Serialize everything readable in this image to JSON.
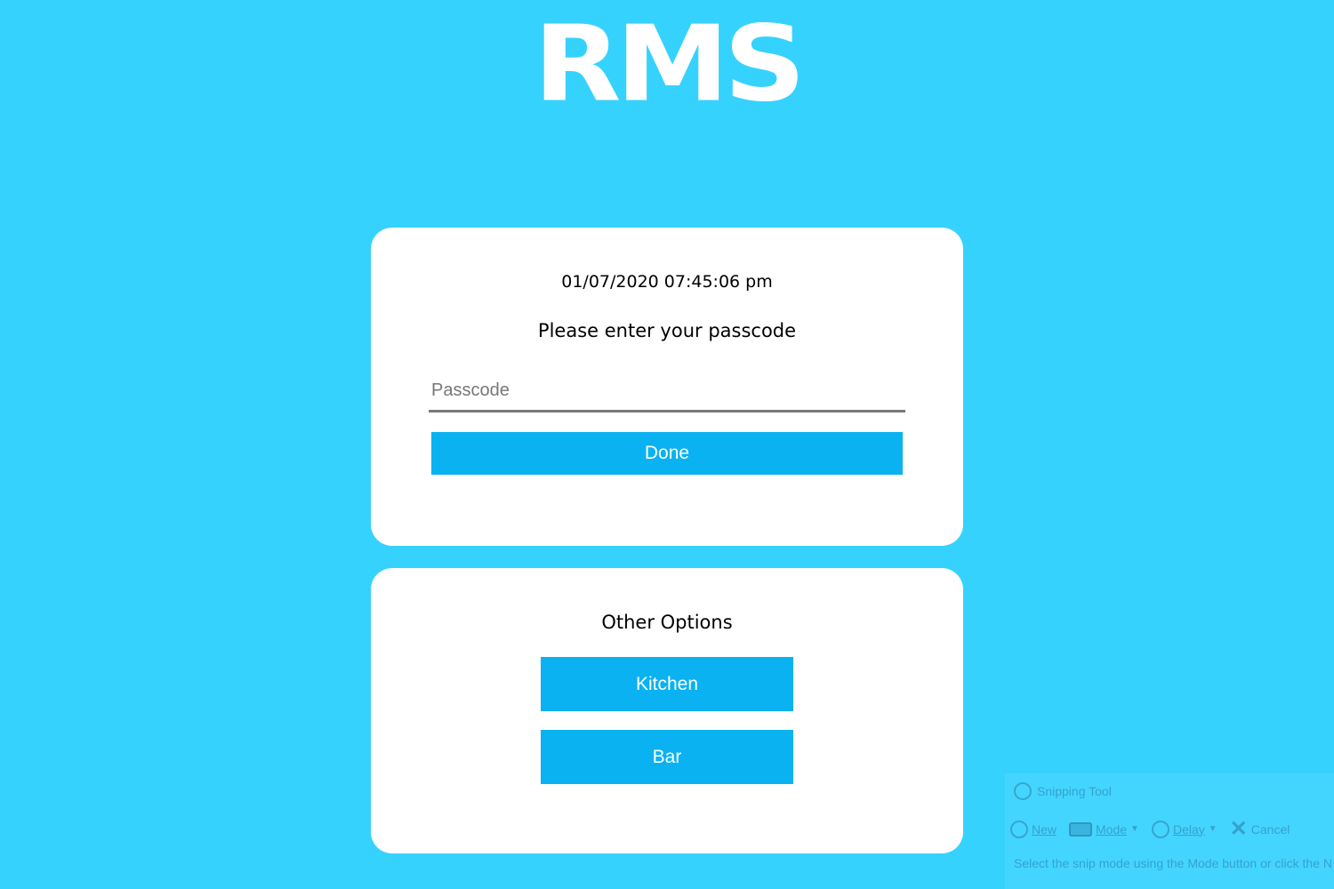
{
  "logo": {
    "text": "RMS"
  },
  "login_card": {
    "datetime": "01/07/2020 07:45:06 pm",
    "prompt": "Please enter your passcode",
    "passcode_placeholder": "Passcode",
    "passcode_value": "",
    "done_label": "Done"
  },
  "options_card": {
    "title": "Other Options",
    "buttons": [
      {
        "label": "Kitchen"
      },
      {
        "label": "Bar"
      }
    ]
  },
  "snipping_tool": {
    "title": "Snipping Tool",
    "toolbar": {
      "new_label": "New",
      "mode_label": "Mode",
      "delay_label": "Delay",
      "cancel_label": "Cancel"
    },
    "message": "Select the snip mode using the Mode button or click the N button."
  },
  "colors": {
    "background": "#36d2fe",
    "card": "#ffffff",
    "button": "#0ab2f1",
    "button_text": "#ffffff"
  }
}
